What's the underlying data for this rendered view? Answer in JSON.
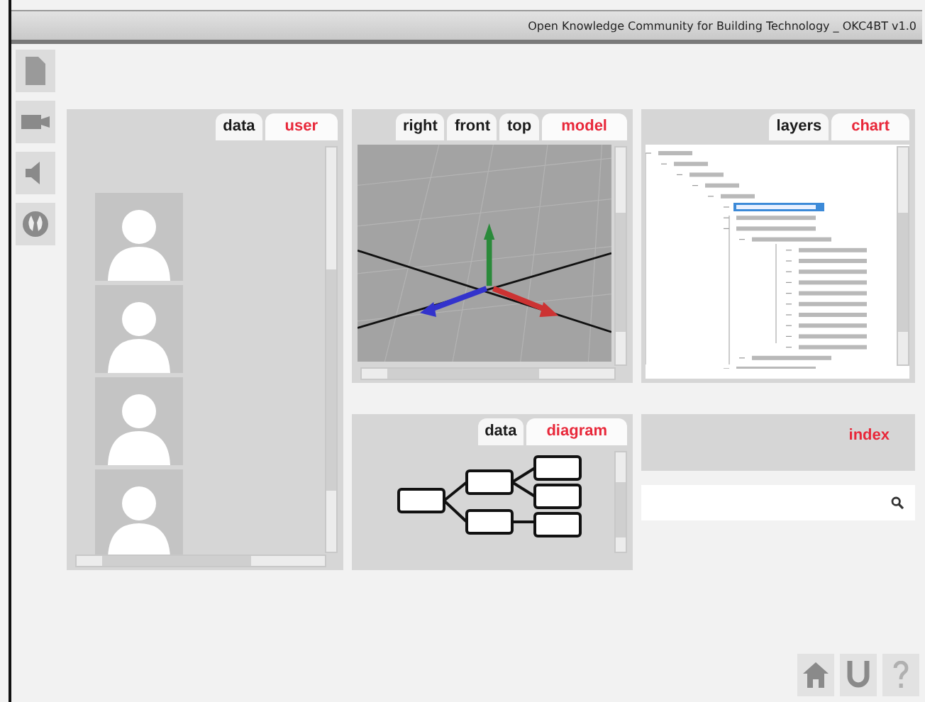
{
  "window": {
    "title": "Open Knowledge Community for Building Technology _ OKC4BT v1.0"
  },
  "user_panel": {
    "tabs": [
      {
        "label": "data",
        "selected": false
      },
      {
        "label": "user",
        "selected": true
      }
    ]
  },
  "model_panel": {
    "tabs": [
      {
        "label": "right",
        "selected": false
      },
      {
        "label": "front",
        "selected": false
      },
      {
        "label": "top",
        "selected": false
      },
      {
        "label": "model",
        "selected": true
      }
    ]
  },
  "layers_panel": {
    "tabs": [
      {
        "label": "layers",
        "selected": false
      },
      {
        "label": "chart",
        "selected": true
      }
    ]
  },
  "diagram_panel": {
    "tabs": [
      {
        "label": "data",
        "selected": false
      },
      {
        "label": "diagram",
        "selected": true
      }
    ]
  },
  "index_panel": {
    "tabs": [
      {
        "label": "index",
        "selected": true
      }
    ]
  }
}
